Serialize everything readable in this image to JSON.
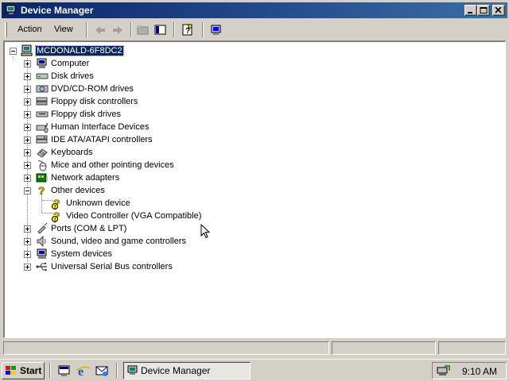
{
  "window": {
    "title": "Device Manager"
  },
  "menu": {
    "action_label": "Action",
    "view_label": "View"
  },
  "tree": {
    "root": "MCDONALD-6F8DC2",
    "items": [
      {
        "label": "Computer",
        "icon": "computer-icon"
      },
      {
        "label": "Disk drives",
        "icon": "disk-drive-icon"
      },
      {
        "label": "DVD/CD-ROM drives",
        "icon": "cdrom-icon"
      },
      {
        "label": "Floppy disk controllers",
        "icon": "floppy-controller-icon"
      },
      {
        "label": "Floppy disk drives",
        "icon": "floppy-drive-icon"
      },
      {
        "label": "Human Interface Devices",
        "icon": "hid-icon"
      },
      {
        "label": "IDE ATA/ATAPI controllers",
        "icon": "ide-controller-icon"
      },
      {
        "label": "Keyboards",
        "icon": "keyboard-icon"
      },
      {
        "label": "Mice and other pointing devices",
        "icon": "mouse-icon"
      },
      {
        "label": "Network adapters",
        "icon": "network-adapter-icon"
      },
      {
        "label": "Other devices",
        "icon": "question-icon",
        "children": [
          {
            "label": "Unknown device",
            "icon": "warning-device-icon"
          },
          {
            "label": "Video Controller (VGA Compatible)",
            "icon": "warning-device-icon"
          }
        ]
      },
      {
        "label": "Ports (COM & LPT)",
        "icon": "port-icon"
      },
      {
        "label": "Sound, video and game controllers",
        "icon": "sound-icon"
      },
      {
        "label": "System devices",
        "icon": "system-devices-icon"
      },
      {
        "label": "Universal Serial Bus controllers",
        "icon": "usb-icon"
      }
    ]
  },
  "taskbar": {
    "start_label": "Start",
    "task_label": "Device Manager",
    "clock": "9:10 AM"
  }
}
